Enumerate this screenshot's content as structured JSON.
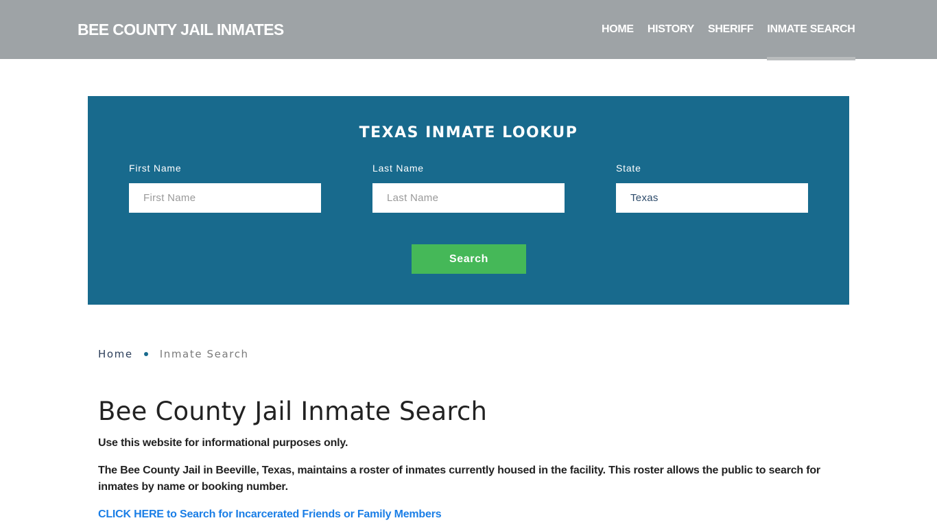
{
  "header": {
    "brand": "BEE COUNTY JAIL INMATES",
    "nav": [
      {
        "label": "HOME",
        "active": false
      },
      {
        "label": "HISTORY",
        "active": false
      },
      {
        "label": "SHERIFF",
        "active": false
      },
      {
        "label": "INMATE SEARCH",
        "active": true
      }
    ]
  },
  "lookup": {
    "title": "TEXAS INMATE LOOKUP",
    "fields": {
      "first_name": {
        "label": "First Name",
        "placeholder": "First Name",
        "value": ""
      },
      "last_name": {
        "label": "Last Name",
        "placeholder": "Last Name",
        "value": ""
      },
      "state": {
        "label": "State",
        "value": "Texas"
      }
    },
    "search_label": "Search"
  },
  "breadcrumb": {
    "home": "Home",
    "current": "Inmate Search"
  },
  "content": {
    "title": "Bee County Jail Inmate Search",
    "disclaimer": "Use this website for informational purposes only.",
    "description": "The Bee County Jail in Beeville, Texas, maintains a roster of inmates currently housed in the facility. This roster allows the public to search for inmates by name or booking number.",
    "cta_link": "CLICK HERE to Search for Incarcerated Friends or Family Members"
  },
  "colors": {
    "header_bg": "#9ea3a6",
    "lookup_bg": "#186a8d",
    "search_button": "#45b858",
    "link": "#1a7ee6"
  }
}
